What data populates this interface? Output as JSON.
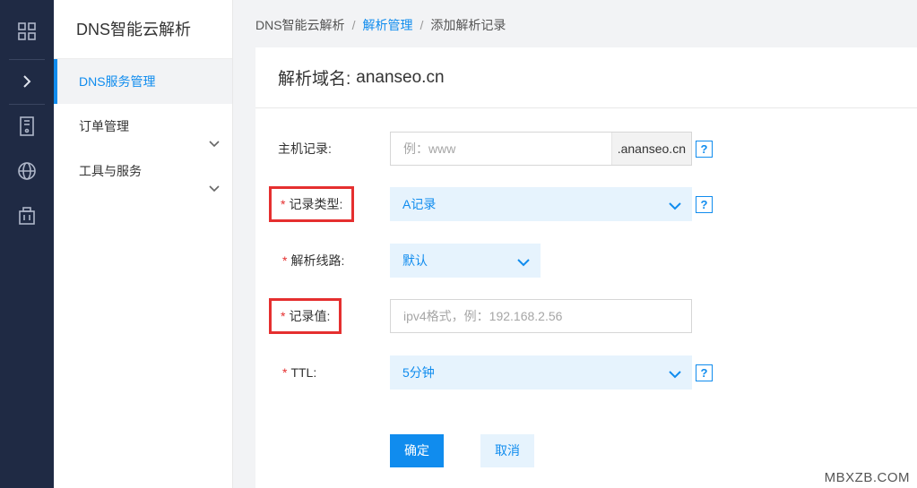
{
  "rail": {
    "items": [
      {
        "icon": "grid-icon"
      },
      {
        "icon": "chevron-right-icon"
      },
      {
        "icon": "server-icon"
      },
      {
        "icon": "globe-icon"
      },
      {
        "icon": "building-icon"
      }
    ]
  },
  "sidebar": {
    "title": "DNS智能云解析",
    "items": [
      {
        "label": "DNS服务管理",
        "active": true
      },
      {
        "label": "订单管理",
        "expandable": true
      },
      {
        "label": "工具与服务",
        "expandable": true
      }
    ]
  },
  "breadcrumb": {
    "root": "DNS智能云解析",
    "sep": "/",
    "middle": "解析管理",
    "current": "添加解析记录"
  },
  "card": {
    "title_label": "解析域名:",
    "domain": "ananseo.cn"
  },
  "form": {
    "host": {
      "label": "主机记录:",
      "placeholder": "例：www",
      "suffix": ".ananseo.cn",
      "help": "?"
    },
    "type": {
      "required": "*",
      "label": "记录类型:",
      "value": "A记录",
      "help": "?"
    },
    "line": {
      "required": "*",
      "label": "解析线路:",
      "value": "默认"
    },
    "value": {
      "required": "*",
      "label": "记录值:",
      "placeholder": "ipv4格式，例：192.168.2.56"
    },
    "ttl": {
      "required": "*",
      "label": "TTL:",
      "value": "5分钟",
      "help": "?"
    }
  },
  "buttons": {
    "confirm": "确定",
    "cancel": "取消"
  },
  "watermark": "MBXZB.COM",
  "colors": {
    "accent": "#108cee",
    "rail": "#1f2a44",
    "highlight_box": "#e52f2f"
  }
}
